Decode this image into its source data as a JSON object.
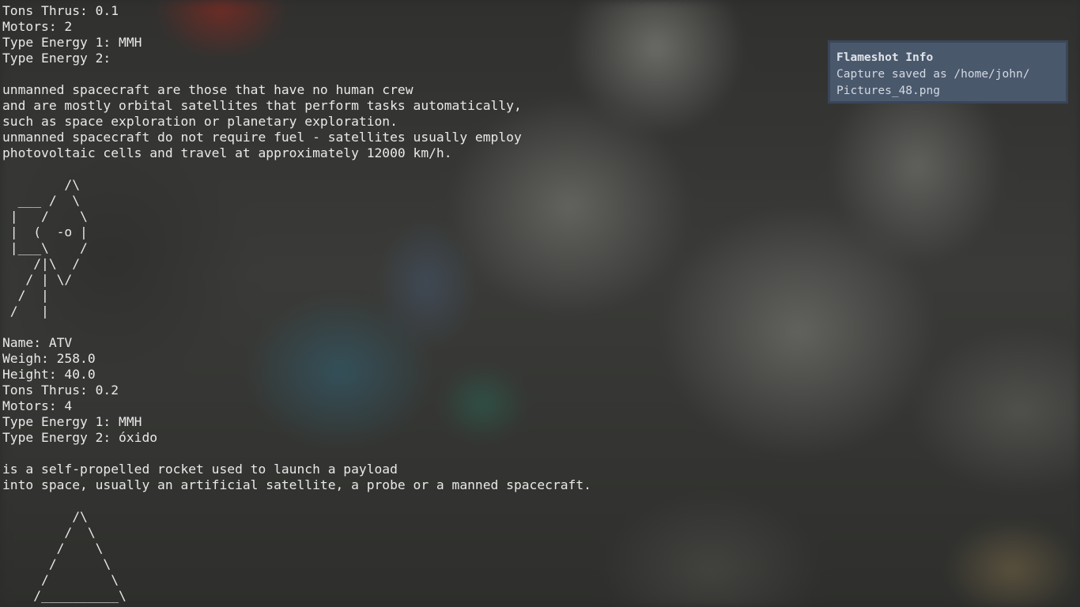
{
  "terminal": {
    "lines": [
      "Tons Thrus: 0.1",
      "Motors: 2",
      "Type Energy 1: MMH",
      "Type Energy 2:",
      "",
      "unmanned spacecraft are those that have no human crew",
      "and are mostly orbital satellites that perform tasks automatically,",
      "such as space exploration or planetary exploration.",
      "unmanned spacecraft do not require fuel - satellites usually employ",
      "photovoltaic cells and travel at approximately 12000 km/h.",
      "",
      "        /\\",
      "  ___ /  \\",
      " |   /    \\",
      " |  (  -o |",
      " |___\\    /",
      "    /|\\  /",
      "   / | \\/",
      "  /  |",
      " /   |",
      "",
      "Name: ATV",
      "Weigh: 258.0",
      "Height: 40.0",
      "Tons Thrus: 0.2",
      "Motors: 4",
      "Type Energy 1: MMH",
      "Type Energy 2: óxido",
      "",
      "is a self-propelled rocket used to launch a payload",
      "into space, usually an artificial satellite, a probe or a manned spacecraft.",
      "",
      "         /\\",
      "        /  \\",
      "       /    \\",
      "      /      \\",
      "     /        \\",
      "    /__________\\"
    ]
  },
  "notification": {
    "title": "Flameshot Info",
    "body_line_1": "Capture saved as /home/john/",
    "body_line_2": "Pictures_48.png",
    "background_color": "#4a586c"
  }
}
